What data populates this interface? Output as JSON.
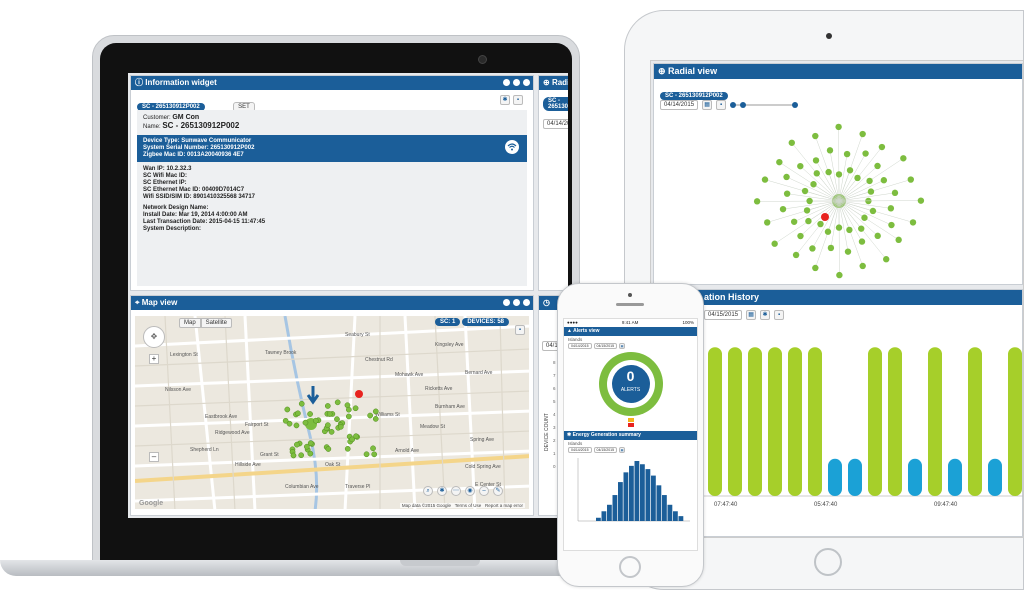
{
  "colors": {
    "brand_blue": "#1b5e99",
    "green": "#7dbd3f",
    "lime": "#a6cf2a",
    "cyan": "#1ba1d6",
    "red": "#e8231f"
  },
  "info_widget": {
    "title": "Information widget",
    "sc_pill": "SC - 265130912P002",
    "set_button": "SET",
    "customer_label": "Customer:",
    "customer_value": "GM Con",
    "name_label": "Name:",
    "name_value": "SC - 265130912P002",
    "band_lines": [
      "Device Type: Sunwave Communicator",
      "System Serial Number: 265130912P002",
      "Zigbee Mac ID: 0013A20040936 4E7"
    ],
    "detail_lines": [
      "Wan IP: 10.2.32.3",
      "SC Wifi Mac ID:",
      "SC Ethernet IP:",
      "SC Ethernet Mac ID: 00409D7014C7",
      "Wifi SSID/SIM ID: 8901410325568 34717"
    ],
    "network_lines": [
      "Network Design Name:",
      "Install Date: Mar 19, 2014 4:00:00 AM",
      "Last Transaction Date: 2015-04-15 11:47:45",
      "System Description:"
    ]
  },
  "radial_small": {
    "title": "Radial view",
    "sc_pill": "SC - 265130912P002",
    "date": "04/14/2015"
  },
  "map_view": {
    "title": "Map view",
    "map_tab": "Map",
    "satellite_tab": "Satellite",
    "sc_badge": "SC: 1",
    "devices_badge": "DEVICES: 58",
    "attribution": "Map data ©2015 Google",
    "terms": "Terms of Use",
    "report": "Report a map error",
    "google": "Google",
    "street_labels": [
      "Tawney Brook",
      "Seabury St",
      "Kingsley Ave",
      "Bernard Ave",
      "Ricketts Ave",
      "Burnham Ave",
      "Williams St",
      "Meadow St",
      "Arnold Ave",
      "Cold Spring Ave",
      "Spring Ave",
      "E Center St",
      "Traverse Pl",
      "Columbian Ave",
      "Ridgewood Ave",
      "Fairport St",
      "Grant St",
      "Hillside Ave",
      "Shepherd Ln",
      "Eastbrook Ave",
      "Nilsson Ave",
      "Lexington St",
      "Mohawk Ave",
      "Oak St",
      "Chestnut Rd"
    ]
  },
  "ipad": {
    "radial_title": "Radial view",
    "sc_pill": "SC - 265130912P002",
    "date": "04/14/2015",
    "history_title": "ation History",
    "history_date": "04/15/2015",
    "x_ticks": [
      "05:47:40",
      "09:47:40"
    ],
    "left_tick": "07:47:40"
  },
  "laptop_partial": {
    "date": "04/14/2015",
    "y_label": "DEVICE COUNT",
    "y_ticks": [
      "8",
      "7",
      "6",
      "5",
      "4",
      "3",
      "2",
      "1",
      "0"
    ]
  },
  "phone": {
    "time": "9:41 AM",
    "battery": "100%",
    "alerts_title": "Alerts view",
    "alerts_sub": "Islands",
    "alerts_count": "0",
    "alerts_label": "ALERTS",
    "energy_title": "Energy Generation summary",
    "energy_sub": "Islands",
    "d1": "04/14/2015",
    "d2": "04/15/2015"
  },
  "chart_data": [
    {
      "type": "bar",
      "title": "",
      "series": [
        {
          "values": [
            8,
            8,
            8,
            8,
            8,
            8,
            0,
            0,
            8,
            8,
            0,
            8,
            0,
            8,
            0,
            8
          ]
        },
        {
          "values": [
            0,
            0,
            0,
            0,
            0,
            0,
            2,
            2,
            0,
            0,
            2,
            0,
            2,
            0,
            2,
            0
          ]
        }
      ]
    },
    {
      "type": "bar",
      "title": "Energy Generation summary",
      "values": [
        2,
        6,
        10,
        16,
        24,
        30,
        34,
        37,
        35,
        32,
        28,
        22,
        16,
        10,
        6,
        3
      ]
    }
  ]
}
